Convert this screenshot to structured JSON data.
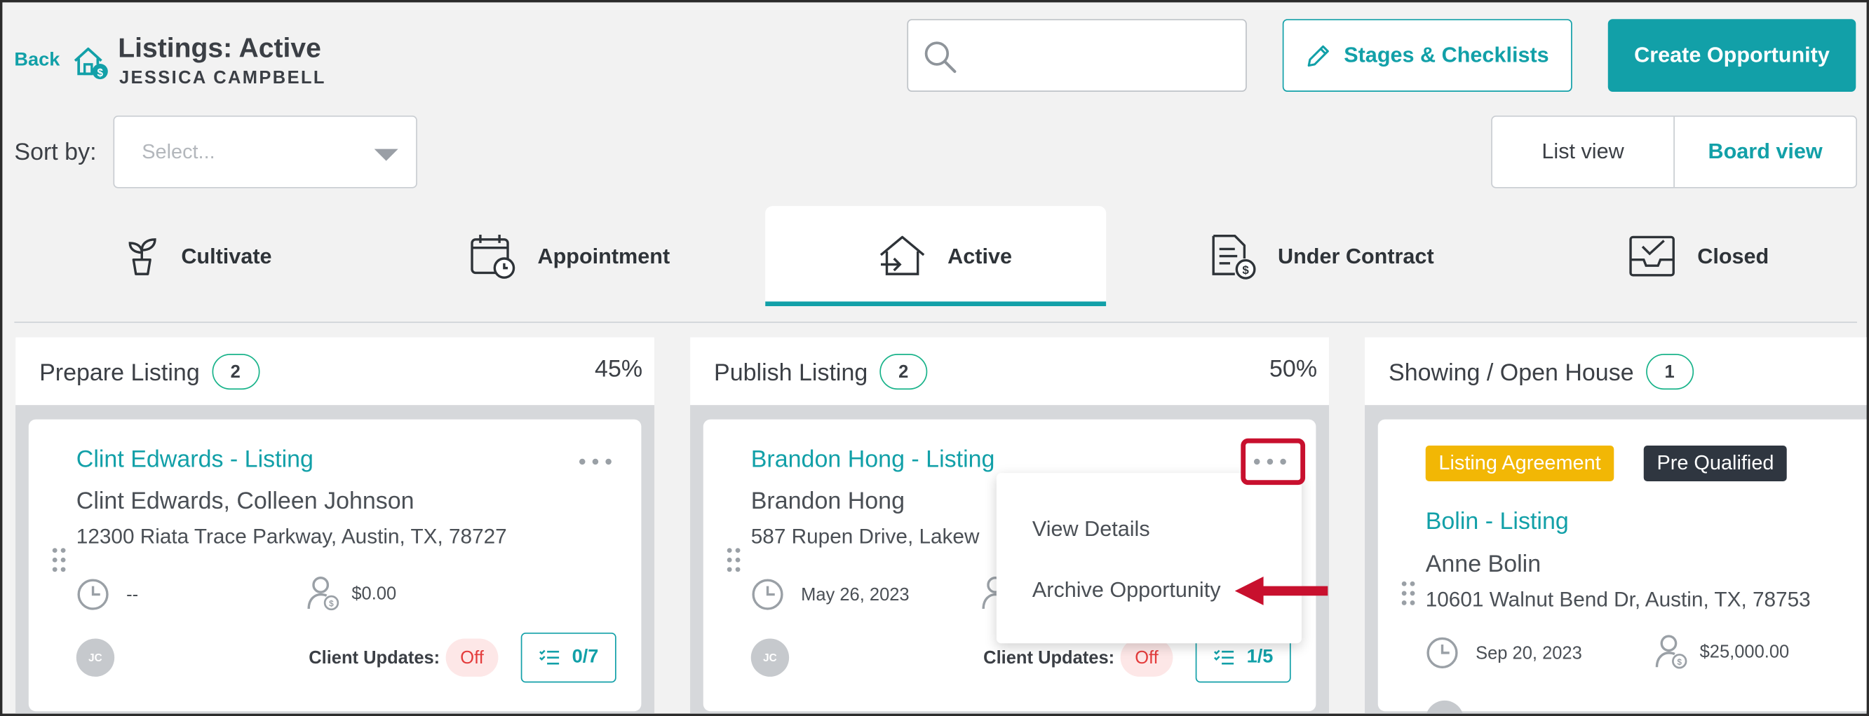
{
  "header": {
    "back_label": "Back",
    "title": "Listings: Active",
    "subtitle": "JESSICA CAMPBELL",
    "search_placeholder": "",
    "stages_button_label": "Stages & Checklists",
    "create_button_label": "Create Opportunity"
  },
  "sort": {
    "label": "Sort by:",
    "placeholder": "Select..."
  },
  "view_toggle": {
    "list_label": "List view",
    "board_label": "Board view",
    "selected": "Board view"
  },
  "stage_tabs": [
    {
      "label": "Cultivate",
      "icon": "plant-icon"
    },
    {
      "label": "Appointment",
      "icon": "calendar-clock-icon"
    },
    {
      "label": "Active",
      "icon": "house-arrow-icon",
      "selected": true
    },
    {
      "label": "Under Contract",
      "icon": "contract-document-icon"
    },
    {
      "label": "Closed",
      "icon": "inbox-check-icon"
    }
  ],
  "columns": [
    {
      "title": "Prepare Listing",
      "count": "2",
      "percent": "45%",
      "card": {
        "title": "Clint Edwards - Listing",
        "clients": "Clint Edwards, Colleen Johnson",
        "address": "12300 Riata Trace Parkway, Austin, TX, 78727",
        "date": "--",
        "price": "$0.00",
        "avatar_initials": "JC",
        "client_updates_label": "Client Updates:",
        "client_updates_status": "Off",
        "checklist_progress": "0/7"
      }
    },
    {
      "title": "Publish Listing",
      "count": "2",
      "percent": "50%",
      "card": {
        "title": "Brandon Hong - Listing",
        "clients": "Brandon Hong",
        "address": "587 Rupen Drive, Lakew",
        "date": "May 26, 2023",
        "avatar_initials": "JC",
        "client_updates_label": "Client Updates:",
        "client_updates_status": "Off",
        "checklist_progress": "1/5"
      }
    },
    {
      "title": "Showing / Open House",
      "count": "1",
      "card": {
        "tags": [
          {
            "label": "Listing Agreement",
            "color": "#f2b705"
          },
          {
            "label": "Pre Qualified",
            "color": "#2f3640"
          }
        ],
        "title": "Bolin - Listing",
        "clients": "Anne Bolin",
        "address": "10601 Walnut Bend Dr, Austin, TX, 78753",
        "date": "Sep 20, 2023",
        "price": "$25,000.00"
      }
    }
  ],
  "context_menu": {
    "items": [
      "View Details",
      "Archive Opportunity"
    ]
  },
  "colors": {
    "accent": "#12a0a8",
    "highlight": "#c8102e",
    "badge_off_bg": "#fde7e7",
    "badge_off_text": "#e43b3b"
  }
}
